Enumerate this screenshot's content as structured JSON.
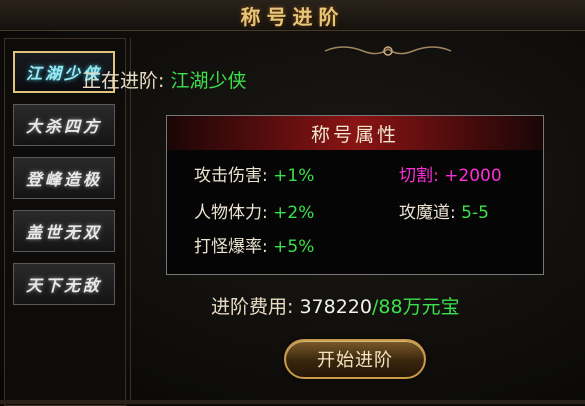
{
  "window": {
    "title": "称号进阶"
  },
  "sidebar": {
    "items": [
      {
        "label": "江湖少侠",
        "active": true
      },
      {
        "label": "大杀四方",
        "active": false
      },
      {
        "label": "登峰造极",
        "active": false
      },
      {
        "label": "盖世无双",
        "active": false
      },
      {
        "label": "天下无敌",
        "active": false
      }
    ]
  },
  "advancing": {
    "label": "正在进阶:",
    "title_name": "江湖少侠"
  },
  "attributes": {
    "header": "称号属性",
    "items": [
      {
        "label": "攻击伤害:",
        "value": "+1%"
      },
      {
        "label": "切割:",
        "value": "+2000"
      },
      {
        "label": "人物体力:",
        "value": "+2%"
      },
      {
        "label": "攻魔道:",
        "value": "5-5"
      },
      {
        "label": "打怪爆率:",
        "value": "+5%"
      }
    ]
  },
  "cost": {
    "label": "进阶费用:",
    "amount": "378220",
    "total": "/88万元宝"
  },
  "start_button": {
    "label": "开始进阶"
  },
  "colors": {
    "gold": "#e6c47a",
    "green": "#3ce04a",
    "magenta": "#ff2ed8",
    "header_red": "#8a1414",
    "active_border": "#e2c37d"
  }
}
